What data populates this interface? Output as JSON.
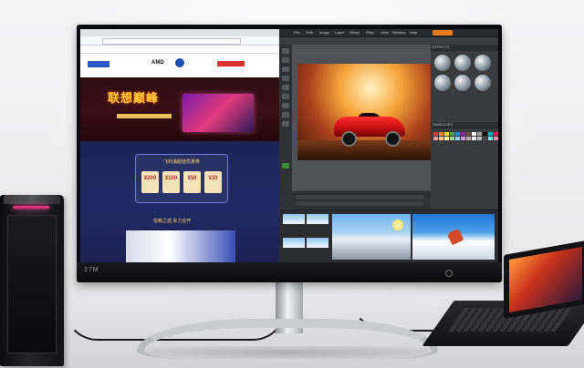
{
  "monitor": {
    "brand": "27M"
  },
  "browser": {
    "logo_amd": "AMD",
    "promo_title": "联想巅峰",
    "coupon_title": "飞利浦超值优惠券",
    "coupons": [
      {
        "value": "¥200"
      },
      {
        "value": "¥100"
      },
      {
        "value": "¥50"
      },
      {
        "value": "¥30"
      }
    ],
    "section_title": "信赖之选 实力全开"
  },
  "editor": {
    "menu": [
      "File",
      "Edit",
      "Image",
      "Layer",
      "Select",
      "Filter",
      "View",
      "Window",
      "Help"
    ],
    "effects_label": "EFFECTS",
    "swatches_label": "SWATCHES",
    "swatch_colors": [
      "#e53935",
      "#fb8c00",
      "#fdd835",
      "#43a047",
      "#1e88e5",
      "#8e24aa",
      "#6d4c41",
      "#ffffff",
      "#9e9e9e",
      "#000000",
      "#00acc1",
      "#d81b60",
      "#ef9a9a",
      "#ffcc80",
      "#fff59d",
      "#a5d6a7",
      "#90caf9",
      "#ce93d8",
      "#bcaaa4",
      "#eeeeee",
      "#bdbdbd",
      "#424242",
      "#80deea",
      "#f48fb1"
    ]
  }
}
